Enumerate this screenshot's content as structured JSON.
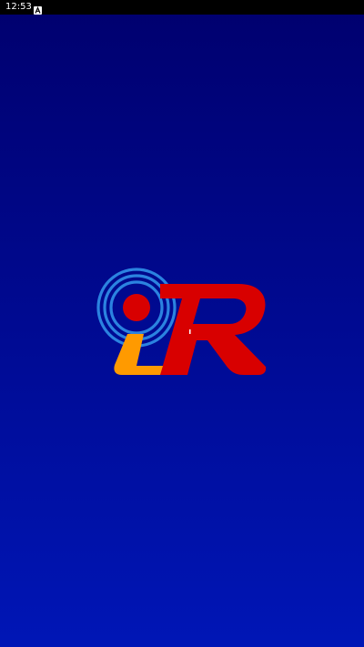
{
  "status_bar": {
    "time": "12:53",
    "notification_icon": "a-letter-icon"
  },
  "splash": {
    "logo_icon": "ilr-radio-logo",
    "logo_text": "iLR",
    "colors": {
      "background_top": "#00006e",
      "background_bottom": "#0016b6",
      "signal_waves": "#2b83e0",
      "dot": "#d80000",
      "letter_l": "#ff9a00",
      "letter_r": "#d80000"
    }
  }
}
